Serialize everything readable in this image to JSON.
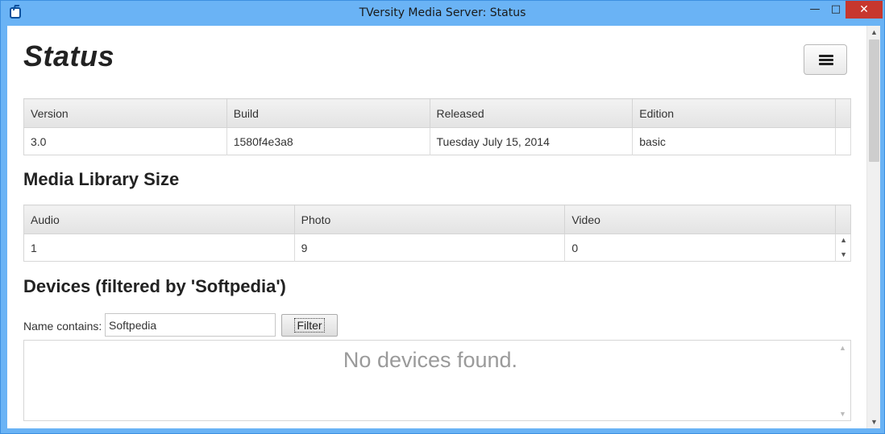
{
  "window": {
    "title": "TVersity Media Server: Status",
    "min_glyph": "—",
    "max_glyph": "□",
    "close_glyph": "✕"
  },
  "page": {
    "title": "Status",
    "menu_icon": "hamburger-menu-icon"
  },
  "version_table": {
    "headers": [
      "Version",
      "Build",
      "Released",
      "Edition"
    ],
    "row": [
      "3.0",
      "1580f4e3a8",
      "Tuesday July 15, 2014",
      "basic"
    ]
  },
  "library": {
    "heading": "Media Library Size",
    "headers": [
      "Audio",
      "Photo",
      "Video"
    ],
    "row": [
      "1",
      "9",
      "0"
    ]
  },
  "devices": {
    "heading": "Devices (filtered by 'Softpedia')",
    "filter_label": "Name contains:",
    "filter_value": "Softpedia",
    "filter_button": "Filter",
    "empty_message": "No devices found."
  },
  "colors": {
    "titlebar": "#6ab3f5",
    "close_button": "#c7372e"
  }
}
